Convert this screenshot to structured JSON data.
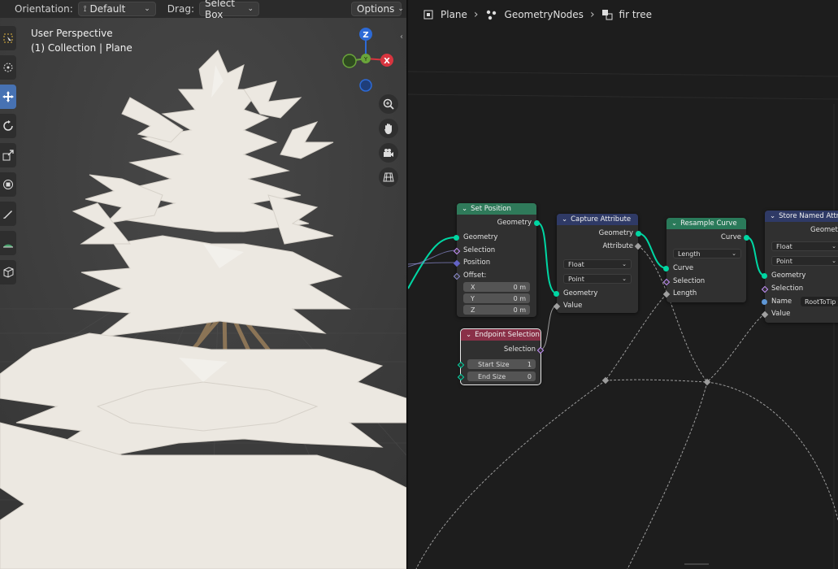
{
  "viewport": {
    "header": {
      "orientation_label": "Orientation:",
      "orientation_value": "Default",
      "drag_label": "Drag:",
      "drag_value": "Select Box",
      "options_label": "Options"
    },
    "perspective_title": "User Perspective",
    "collection_label": "(1) Collection | Plane",
    "gizmo": {
      "z": "Z",
      "y": "Y",
      "x": "X"
    },
    "tools": [
      "select-box",
      "cursor",
      "move",
      "rotate",
      "scale",
      "transform",
      "annotate",
      "measure",
      "add-cube"
    ],
    "nav_buttons": [
      "zoom",
      "pan",
      "camera",
      "ortho-grid"
    ]
  },
  "node_editor": {
    "breadcrumb": [
      "Plane",
      "GeometryNodes",
      "fir tree"
    ],
    "nodes": {
      "set_position": {
        "title": "Set Position",
        "header_color": "#2f7a5a",
        "output_geometry": "Geometry",
        "inputs": [
          "Geometry",
          "Selection",
          "Position",
          "Offset:"
        ],
        "offset": [
          {
            "axis": "X",
            "value": "0 m"
          },
          {
            "axis": "Y",
            "value": "0 m"
          },
          {
            "axis": "Z",
            "value": "0 m"
          }
        ]
      },
      "capture_attribute": {
        "title": "Capture Attribute",
        "header_color": "#2f3a66",
        "outputs": [
          "Geometry",
          "Attribute"
        ],
        "type": "Float",
        "domain": "Point",
        "inputs": [
          "Geometry",
          "Value"
        ]
      },
      "resample_curve": {
        "title": "Resample Curve",
        "header_color": "#2a7a5a",
        "output": "Curve",
        "mode": "Length",
        "inputs": [
          "Curve",
          "Selection",
          "Length"
        ]
      },
      "store_named_attribute": {
        "title": "Store Named Attribute",
        "header_color": "#2f3a66",
        "output": "Geometry",
        "type": "Float",
        "domain": "Point",
        "inputs": [
          "Geometry",
          "Selection",
          "Name",
          "Value"
        ],
        "name_value": "RootToTip"
      },
      "endpoint_selection": {
        "title": "Endpoint Selection",
        "header_color": "#8a3048",
        "output": "Selection",
        "start_size_label": "Start Size",
        "start_size_value": "1",
        "end_size_label": "End Size",
        "end_size_value": "0"
      }
    }
  },
  "colors": {
    "geometry_socket": "#00d6a3",
    "float_socket": "#a1a1a1",
    "active_tool": "#4772b3",
    "gizmo_z": "#2d6ad6",
    "gizmo_y": "#6aa53a",
    "gizmo_x": "#d8353f"
  }
}
